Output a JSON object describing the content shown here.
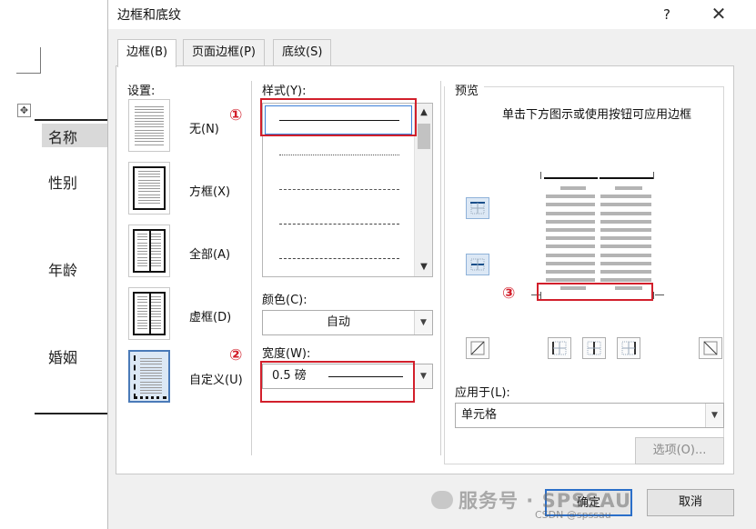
{
  "document": {
    "rows": [
      "名称",
      "性别",
      "年龄",
      "婚姻"
    ],
    "move_icon": "move-handle-icon"
  },
  "dialog": {
    "title": "边框和底纹",
    "help": "?",
    "close": "✕",
    "tabs": [
      "边框(B)",
      "页面边框(P)",
      "底纹(S)"
    ],
    "settings_label": "设置:",
    "settings": [
      "无(N)",
      "方框(X)",
      "全部(A)",
      "虚框(D)",
      "自定义(U)"
    ],
    "style_label": "样式(Y):",
    "color_label": "颜色(C):",
    "color_value": "自动",
    "width_label": "宽度(W):",
    "width_value": "0.5 磅",
    "preview_label": "预览",
    "preview_hint": "单击下方图示或使用按钮可应用边框",
    "apply_label": "应用于(L):",
    "apply_value": "单元格",
    "options_button": "选项(O)...",
    "ok_button": "确定",
    "cancel_button": "取消",
    "annotations": [
      "①",
      "②",
      "③"
    ]
  },
  "watermark": {
    "text": "服务号 · SPSSAU",
    "source": "CSDN @spssau"
  },
  "colors": {
    "highlight": "#d21f2b",
    "selection": "#3b7ed8"
  }
}
